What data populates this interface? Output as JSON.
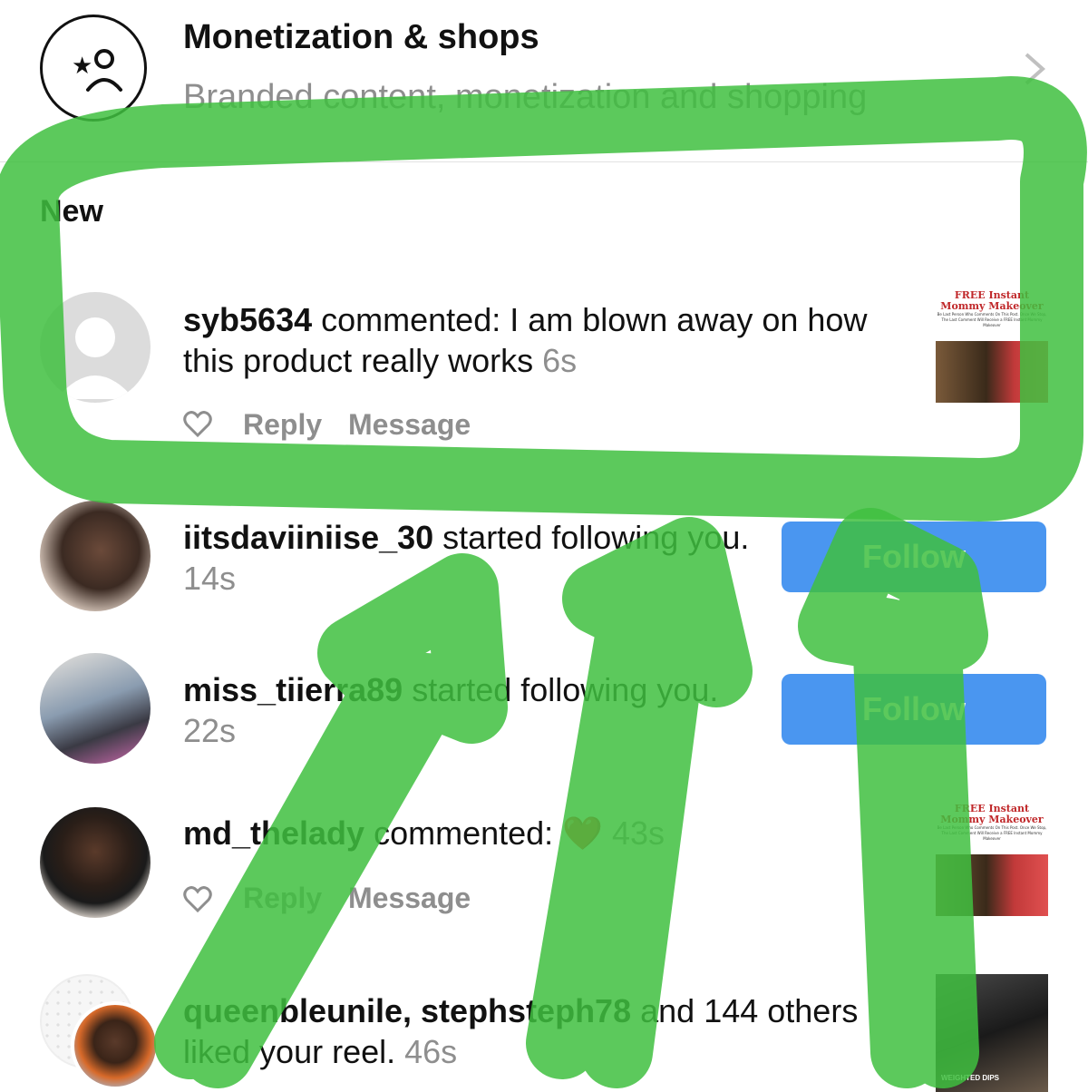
{
  "settings_row": {
    "title": "Monetization & shops",
    "subtitle": "Branded content, monetization and shopping"
  },
  "section_header": "New",
  "notifications": [
    {
      "type": "comment",
      "username": "syb5634",
      "action_text": "commented: I am blown away on how this product really works",
      "time": "6s",
      "like_icon": "heart-outline-icon",
      "reply_label": "Reply",
      "message_label": "Message",
      "thumbnail": {
        "title": "FREE Instant Mommy Makeover",
        "text": "Be Last Person Who Comments On This Post. Once We Stop, The Last Comment Will Receive a FREE Instant Mommy Makeover"
      }
    },
    {
      "type": "follow",
      "username": "iitsdaviiniise_30",
      "action_text": "started following you.",
      "time": "14s",
      "button_label": "Follow"
    },
    {
      "type": "follow",
      "username": "miss_tiierra89",
      "action_text": "started following you.",
      "time": "22s",
      "button_label": "Follow"
    },
    {
      "type": "comment",
      "username": "md_thelady",
      "action_text": "commented: ❤️",
      "time": "43s",
      "like_icon": "heart-outline-icon",
      "reply_label": "Reply",
      "message_label": "Message",
      "thumbnail": {
        "title": "FREE Instant Mommy Makeover",
        "text": "Be Last Person Who Comments On This Post. Once We Stop, The Last Comment Will Receive a FREE Instant Mommy Makeover"
      }
    },
    {
      "type": "like",
      "username": "queenbleunile, stephsteph78",
      "action_text": "and 144 others liked your reel.",
      "count_text": "144",
      "time": "46s",
      "thumbnail": {
        "caption": "WEIGHTED DIPS"
      }
    }
  ],
  "colors": {
    "accent_blue": "#4a96f0",
    "markup_green": "#3fbf3f",
    "secondary_text": "#8e8e8e"
  }
}
